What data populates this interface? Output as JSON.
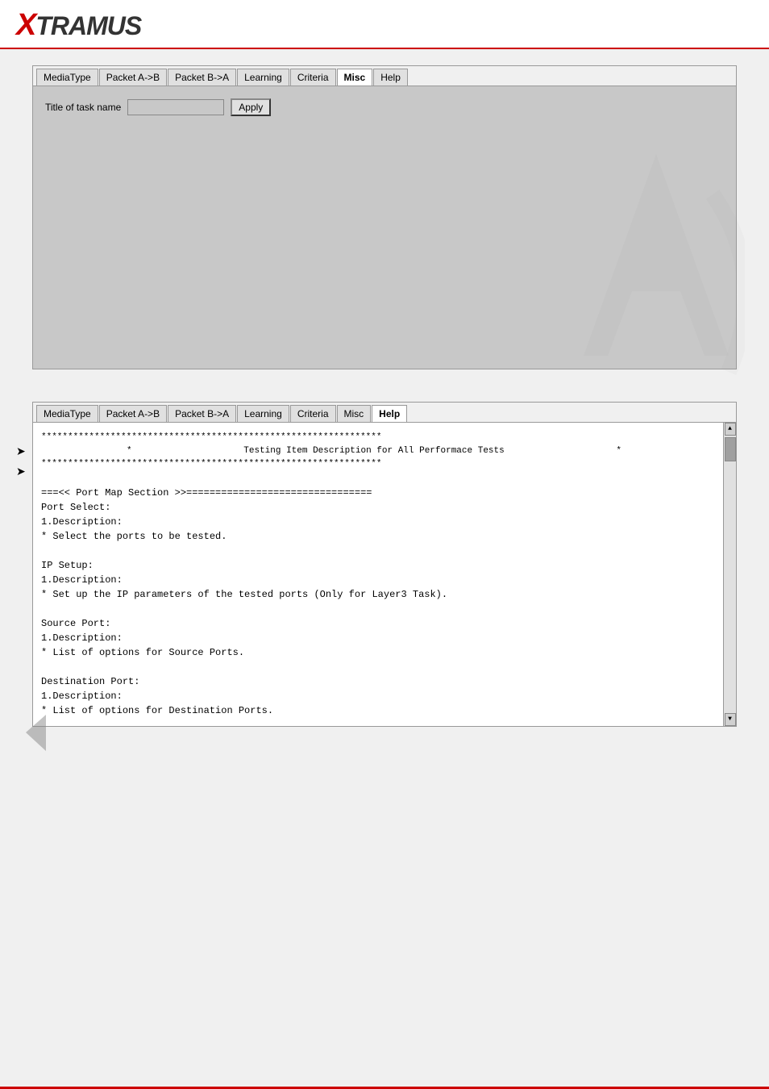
{
  "header": {
    "logo": "XTRAMUS",
    "logo_x": "X",
    "logo_rest": "TRAMUS"
  },
  "top_panel": {
    "tabs": [
      {
        "label": "MediaType",
        "active": false
      },
      {
        "label": "Packet A->B",
        "active": false
      },
      {
        "label": "Packet B->A",
        "active": false
      },
      {
        "label": "Learning",
        "active": false
      },
      {
        "label": "Criteria",
        "active": false
      },
      {
        "label": "Misc",
        "active": true
      },
      {
        "label": "Help",
        "active": false
      }
    ],
    "task_name_label": "Title of task name",
    "task_name_placeholder": "",
    "apply_btn": "Apply"
  },
  "arrow_markers": [
    {
      "symbol": "➤"
    },
    {
      "symbol": "➤"
    }
  ],
  "bottom_panel": {
    "tabs": [
      {
        "label": "MediaType",
        "active": false
      },
      {
        "label": "Packet A->B",
        "active": false
      },
      {
        "label": "Packet B->A",
        "active": false
      },
      {
        "label": "Learning",
        "active": false
      },
      {
        "label": "Criteria",
        "active": false
      },
      {
        "label": "Misc",
        "active": false
      },
      {
        "label": "Help",
        "active": true
      }
    ],
    "help_content": {
      "stars_top": "****************************************************************",
      "title": "Testing Item Description for All Performace Tests",
      "stars_bottom": "****************************************************************",
      "sections": [
        {
          "separator": "===<< Port Map Section >>================================",
          "items": [
            {
              "name": "Port Select:",
              "sub": "1.Description:",
              "desc": "   * Select the ports to be tested."
            },
            {
              "name": "IP Setup:",
              "sub": "1.Description:",
              "desc": "   * Set up the IP parameters of the tested ports (Only for Layer3 Task)."
            },
            {
              "name": "Source Port:",
              "sub": "1.Description:",
              "desc": "   * List of options for Source Ports."
            },
            {
              "name": "Destination Port:",
              "sub": "1.Description:",
              "desc": "   * List of options for Destination Ports."
            }
          ]
        }
      ]
    }
  }
}
